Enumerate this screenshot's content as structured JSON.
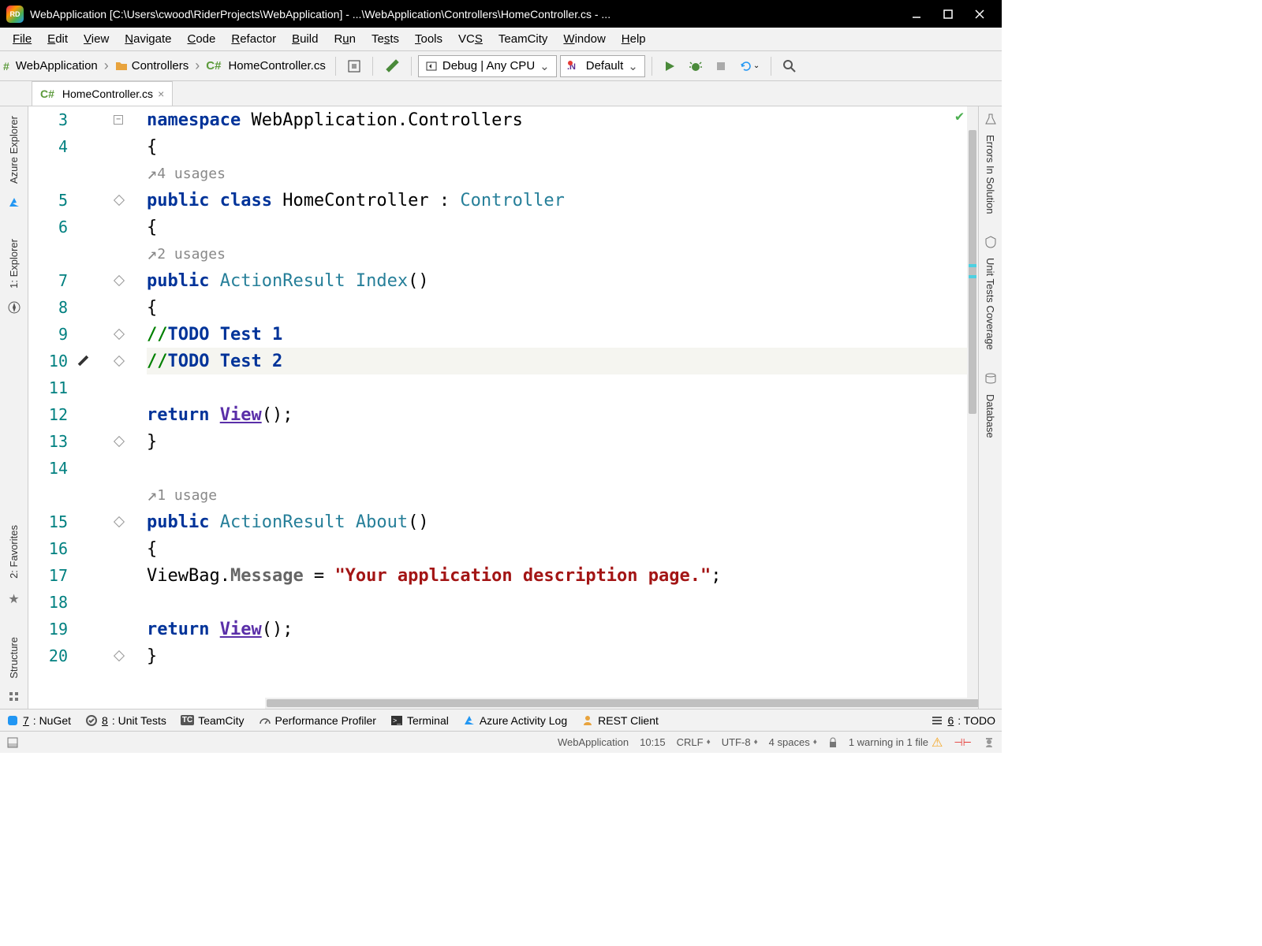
{
  "window": {
    "title": "WebApplication [C:\\Users\\cwood\\RiderProjects\\WebApplication] - ...\\WebApplication\\Controllers\\HomeController.cs - ...",
    "app_icon_label": "RD"
  },
  "menu": [
    "File",
    "Edit",
    "View",
    "Navigate",
    "Code",
    "Refactor",
    "Build",
    "Run",
    "Tests",
    "Tools",
    "VCS",
    "TeamCity",
    "Window",
    "Help"
  ],
  "breadcrumb": {
    "root": "WebApplication",
    "folder": "Controllers",
    "file_prefix": "C#",
    "file": "HomeController.cs"
  },
  "toolbar": {
    "config": "Debug | Any CPU",
    "profile": "Default"
  },
  "tab": {
    "prefix": "C#",
    "name": "HomeController.cs"
  },
  "left_tabs": [
    "Azure Explorer",
    "1: Explorer",
    "2: Favorites",
    "Structure"
  ],
  "right_tabs": [
    "Errors In Solution",
    "Unit Tests Coverage",
    "Database"
  ],
  "code": {
    "line3": {
      "kw": "namespace",
      "ns": " WebApplication.Controllers"
    },
    "line4": "{",
    "u4": "4 usages",
    "line5": {
      "kw": "public class",
      "name": " HomeController ",
      "colon": ": ",
      "base": "Controller"
    },
    "line6": "{",
    "u2": "2 usages",
    "line7": {
      "kw": "public",
      "type": " ActionResult ",
      "name": "Index",
      "paren": "()"
    },
    "line8": "{",
    "line9": {
      "slash": "//",
      "todo": "TODO Test 1"
    },
    "line10": {
      "slash": "//",
      "todo": "TODO Test 2"
    },
    "line12": {
      "kw": "return ",
      "view": "View",
      "rest": "();"
    },
    "line13": "}",
    "u1": "1 usage",
    "line15": {
      "kw": "public",
      "type": " ActionResult ",
      "name": "About",
      "paren": "()"
    },
    "line16": "{",
    "line17": {
      "obj": "ViewBag",
      "dot": ".",
      "prop": "Message",
      "eq": " = ",
      "str": "\"Your application description page.\"",
      "semi": ";"
    },
    "line19": {
      "kw": "return ",
      "view": "View",
      "rest": "();"
    },
    "line20": "}"
  },
  "lnums": [
    "3",
    "4",
    "5",
    "6",
    "7",
    "8",
    "9",
    "10",
    "11",
    "12",
    "13",
    "14",
    "15",
    "16",
    "17",
    "18",
    "19",
    "20"
  ],
  "bottom_tabs": {
    "nuget": {
      "key": "7",
      "label": ": NuGet"
    },
    "unit": {
      "key": "8",
      "label": ": Unit Tests"
    },
    "tc": "TeamCity",
    "perf": "Performance Profiler",
    "term": "Terminal",
    "azure": "Azure Activity Log",
    "rest": "REST Client",
    "todo": {
      "key": "6",
      "label": ": TODO"
    }
  },
  "status": {
    "context": "WebApplication",
    "pos": "10:15",
    "eol": "CRLF",
    "enc": "UTF-8",
    "indent": "4 spaces",
    "warning": "1 warning in 1 file"
  }
}
